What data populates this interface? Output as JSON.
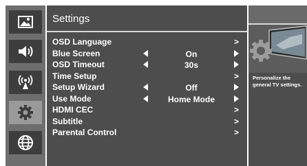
{
  "sidebar": {
    "items": [
      {
        "icon": "picture-icon"
      },
      {
        "icon": "speaker-icon"
      },
      {
        "icon": "antenna-icon"
      },
      {
        "icon": "settings-gear-icon"
      },
      {
        "icon": "globe-icon"
      }
    ],
    "active_index": 3
  },
  "main": {
    "title": "Settings",
    "items": [
      {
        "label": "OSD Language",
        "value": "",
        "control": "submenu"
      },
      {
        "label": "Blue Screen",
        "value": "On",
        "control": "selector"
      },
      {
        "label": "OSD Timeout",
        "value": "30s",
        "control": "selector"
      },
      {
        "label": "Time Setup",
        "value": "",
        "control": "submenu"
      },
      {
        "label": "Setup Wizard",
        "value": "Off",
        "control": "selector"
      },
      {
        "label": "Use Mode",
        "value": "Home Mode",
        "control": "selector"
      },
      {
        "label": "HDMI CEC",
        "value": "",
        "control": "submenu"
      },
      {
        "label": "Subtitle",
        "value": "",
        "control": "submenu"
      },
      {
        "label": "Parental Control",
        "value": "",
        "control": "submenu"
      }
    ],
    "submenu_glyph": ">"
  },
  "info": {
    "description": "Personalize the general TV settings."
  },
  "colors": {
    "panel": "#4d4d4d",
    "sidebar": "#6e6e6e",
    "sidebar_button": "#3d3d3d",
    "sidebar_button_active": "#9a9a9a",
    "text": "#ffffff"
  }
}
